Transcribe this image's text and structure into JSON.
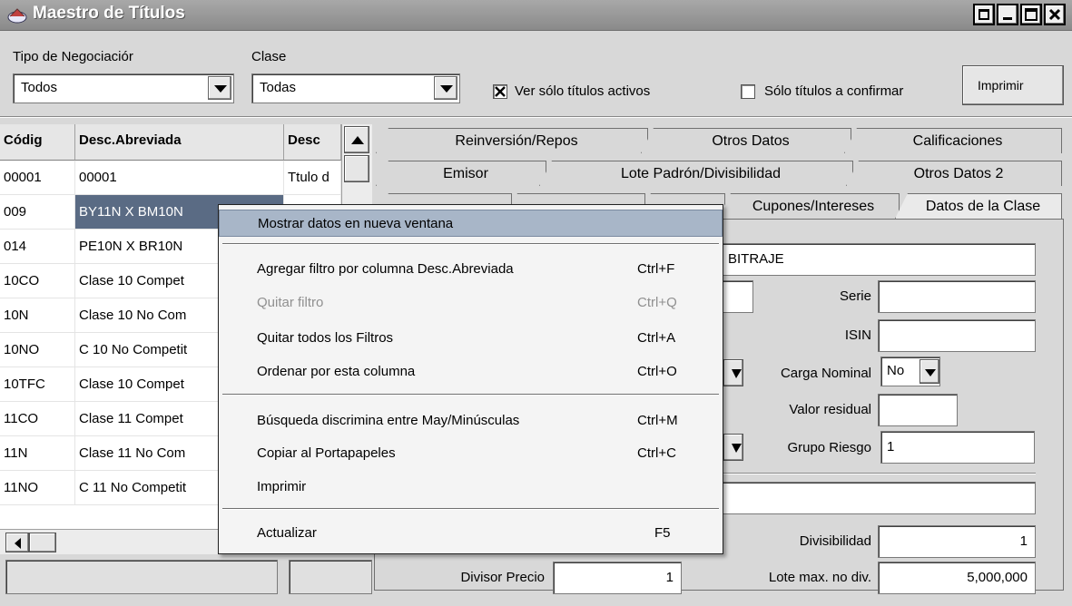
{
  "window": {
    "title": "Maestro de Títulos",
    "controls": [
      "restore",
      "minimize",
      "maximize",
      "close"
    ]
  },
  "filters": {
    "tipo_label": "Tipo de Negociaciór",
    "tipo_value": "Todos",
    "clase_label": "Clase",
    "clase_value": "Todas",
    "chk_activos_label": "Ver sólo títulos activos",
    "chk_activos_checked": true,
    "chk_confirmar_label": "Sólo títulos a confirmar",
    "chk_confirmar_checked": false,
    "print_button": "Imprimir"
  },
  "grid": {
    "columns": [
      "Códig",
      "Desc.Abreviada",
      "Desc"
    ],
    "rows": [
      {
        "code": "00001",
        "abbr": "00001",
        "desc": "Ttulo d"
      },
      {
        "code": "009",
        "abbr": "BY11N X BM10N",
        "desc": ""
      },
      {
        "code": "014",
        "abbr": "PE10N X BR10N",
        "desc": ""
      },
      {
        "code": "10CO",
        "abbr": "Clase 10 Compet",
        "desc": ""
      },
      {
        "code": "10N",
        "abbr": "Clase 10 No Com",
        "desc": ""
      },
      {
        "code": "10NO",
        "abbr": "C 10 No Competit",
        "desc": ""
      },
      {
        "code": "10TFC",
        "abbr": "Clase 10 Compet",
        "desc": ""
      },
      {
        "code": "11CO",
        "abbr": "Clase 11 Compet",
        "desc": ""
      },
      {
        "code": "11N",
        "abbr": "Clase 11 No Com",
        "desc": ""
      },
      {
        "code": "11NO",
        "abbr": "C 11 No Competit",
        "desc": ""
      }
    ]
  },
  "tabs": {
    "row1": [
      "Reinversión/Repos",
      "Otros Datos",
      "Calificaciones"
    ],
    "row2": [
      "Emisor",
      "Lote Padrón/Divisibilidad",
      "Otros Datos 2"
    ],
    "row3": [
      "Cupones/Intereses",
      "Datos de la Clase"
    ]
  },
  "form": {
    "type_value": "BITRAJE",
    "serie_label": "Serie",
    "serie_value": "",
    "isin_label": "ISIN",
    "isin_value": "",
    "carga_nominal_label": "Carga Nominal",
    "carga_nominal_value": "No",
    "valor_residual_label": "Valor residual",
    "valor_residual_value": "",
    "grupo_riesgo_label": "Grupo Riesgo",
    "grupo_riesgo_value": "1",
    "divisibilidad_label": "Divisibilidad",
    "divisibilidad_value": "1",
    "divisor_precio_label": "Divisor Precio",
    "divisor_precio_value": "1",
    "lote_max_label": "Lote max. no div.",
    "lote_max_value": "5,000,000"
  },
  "context_menu": {
    "items": [
      {
        "label": "Mostrar datos en nueva ventana",
        "shortcut": "",
        "enabled": true,
        "selected": true
      },
      {
        "label": "Agregar filtro por columna Desc.Abreviada",
        "shortcut": "Ctrl+F",
        "enabled": true
      },
      {
        "label": "Quitar filtro",
        "shortcut": "Ctrl+Q",
        "enabled": false
      },
      {
        "label": "Quitar todos los Filtros",
        "shortcut": "Ctrl+A",
        "enabled": true
      },
      {
        "label": "Ordenar por esta columna",
        "shortcut": "Ctrl+O",
        "enabled": true
      },
      {
        "label": "Búsqueda discrimina entre May/Minúsculas",
        "shortcut": "Ctrl+M",
        "enabled": true
      },
      {
        "label": "Copiar al Portapapeles",
        "shortcut": "Ctrl+C",
        "enabled": true
      },
      {
        "label": "Imprimir",
        "shortcut": "",
        "enabled": true
      },
      {
        "label": "Actualizar",
        "shortcut": "F5",
        "enabled": true
      }
    ]
  },
  "colors": {
    "titlebar": "#8a8a8a",
    "selection": "#5a6b84",
    "menu_highlight": "#a8b6c8",
    "window_bg": "#d8d8d8"
  }
}
